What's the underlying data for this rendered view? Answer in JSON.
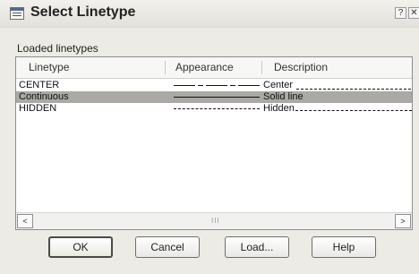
{
  "window": {
    "title": "Select Linetype",
    "help_glyph": "?",
    "close_glyph": "✕"
  },
  "section_label": "Loaded linetypes",
  "columns": [
    "Linetype",
    "Appearance",
    "Description"
  ],
  "rows": [
    {
      "linetype": "CENTER",
      "description": "Center",
      "style": "center",
      "selected": false
    },
    {
      "linetype": "Continuous",
      "description": "Solid line",
      "style": "solid",
      "selected": true
    },
    {
      "linetype": "HIDDEN",
      "description": "Hidden",
      "style": "hidden",
      "selected": false
    }
  ],
  "scrollbar": {
    "left_arrow": "<",
    "right_arrow": ">",
    "grip": "III"
  },
  "buttons": {
    "ok": "OK",
    "cancel": "Cancel",
    "load": "Load...",
    "help": "Help"
  }
}
